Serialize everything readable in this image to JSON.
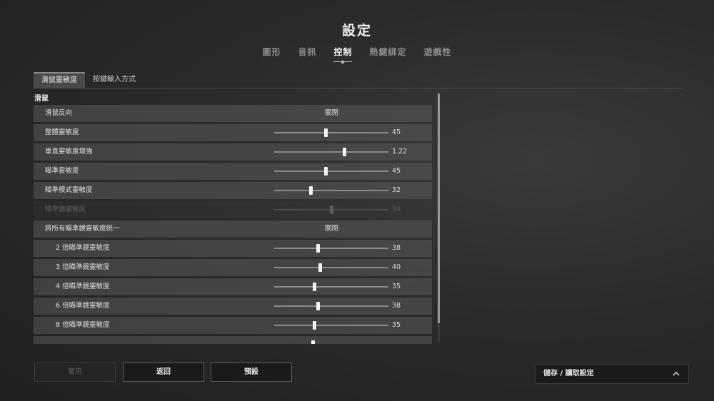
{
  "header": {
    "title": "設定"
  },
  "main_tabs": [
    {
      "label": "圖形",
      "active": false
    },
    {
      "label": "音訊",
      "active": false
    },
    {
      "label": "控制",
      "active": true
    },
    {
      "label": "熱鍵綁定",
      "active": false
    },
    {
      "label": "遊戲性",
      "active": false
    }
  ],
  "sub_tabs": [
    {
      "label": "滑鼠靈敏度",
      "active": true
    },
    {
      "label": "按鍵輸入方式",
      "active": false
    }
  ],
  "section": {
    "label": "滑鼠"
  },
  "rows": [
    {
      "label": "滑鼠反向",
      "type": "toggle",
      "value": "關閉",
      "sub": false,
      "disabled": false
    },
    {
      "label": "整體靈敏度",
      "type": "slider",
      "value": "45",
      "fraction": 0.45,
      "sub": false,
      "disabled": false
    },
    {
      "label": "垂直靈敏度增強",
      "type": "slider",
      "value": "1.22",
      "fraction": 0.61,
      "sub": false,
      "disabled": false
    },
    {
      "label": "瞄準靈敏度",
      "type": "slider",
      "value": "45",
      "fraction": 0.45,
      "sub": false,
      "disabled": false
    },
    {
      "label": "瞄準模式靈敏度",
      "type": "slider",
      "value": "32",
      "fraction": 0.32,
      "sub": false,
      "disabled": false
    },
    {
      "label": "瞄準鏡靈敏度",
      "type": "slider",
      "value": "50",
      "fraction": 0.5,
      "sub": false,
      "disabled": true
    },
    {
      "label": "將所有瞄準鏡靈敏度統一",
      "type": "toggle",
      "value": "關閉",
      "sub": false,
      "disabled": false
    },
    {
      "label": "2 倍瞄準鏡靈敏度",
      "type": "slider",
      "value": "38",
      "fraction": 0.38,
      "sub": true,
      "disabled": false
    },
    {
      "label": "3 倍瞄準鏡靈敏度",
      "type": "slider",
      "value": "40",
      "fraction": 0.4,
      "sub": true,
      "disabled": false
    },
    {
      "label": "4 倍瞄準鏡靈敏度",
      "type": "slider",
      "value": "35",
      "fraction": 0.35,
      "sub": true,
      "disabled": false
    },
    {
      "label": "6 倍瞄準鏡靈敏度",
      "type": "slider",
      "value": "38",
      "fraction": 0.38,
      "sub": true,
      "disabled": false
    },
    {
      "label": "8 倍瞄準鏡靈敏度",
      "type": "slider",
      "value": "35",
      "fraction": 0.35,
      "sub": true,
      "disabled": false
    },
    {
      "label": "",
      "type": "slider",
      "value": "",
      "fraction": 0.34,
      "sub": true,
      "disabled": false
    }
  ],
  "buttons": {
    "apply": "套用",
    "back": "返回",
    "default": "預設"
  },
  "save_load": {
    "label": "儲存 / 讀取設定",
    "icon": "chevron-up-icon"
  }
}
